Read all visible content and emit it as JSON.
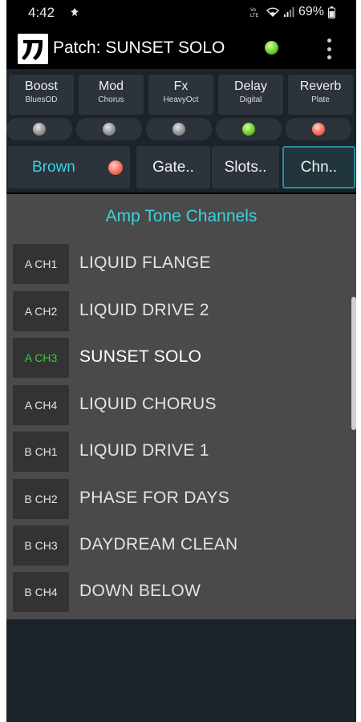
{
  "status_bar": {
    "time": "4:42",
    "battery": "69%",
    "icons": [
      "notification-icon",
      "volte-icon",
      "wifi-icon",
      "signal-icon",
      "battery-icon"
    ]
  },
  "app_bar": {
    "logo": "刀",
    "title": "Patch: SUNSET SOLO",
    "status_color": "#7ed83a",
    "menu_icon": "more-vert-icon"
  },
  "effects": [
    {
      "name": "Boost",
      "type": "BluesOD",
      "led": "grey"
    },
    {
      "name": "Mod",
      "type": "Chorus",
      "led": "grey"
    },
    {
      "name": "Fx",
      "type": "HeavyOct",
      "led": "grey"
    },
    {
      "name": "Delay",
      "type": "Digital",
      "led": "green"
    },
    {
      "name": "Reverb",
      "type": "Plate",
      "led": "red"
    }
  ],
  "nav": {
    "amp": "Brown",
    "amp_led": "red",
    "gate": "Gate..",
    "slots": "Slots..",
    "channels": "Chn.."
  },
  "section_title": "Amp Tone Channels",
  "channels": [
    {
      "label": "A CH1",
      "name": "LIQUID FLANGE",
      "active": false
    },
    {
      "label": "A CH2",
      "name": "LIQUID DRIVE 2",
      "active": false
    },
    {
      "label": "A CH3",
      "name": "SUNSET SOLO",
      "active": true
    },
    {
      "label": "A CH4",
      "name": "LIQUID CHORUS",
      "active": false
    },
    {
      "label": "B CH1",
      "name": "LIQUID DRIVE 1",
      "active": false
    },
    {
      "label": "B CH2",
      "name": "PHASE FOR DAYS",
      "active": false
    },
    {
      "label": "B CH3",
      "name": "DAYDREAM CLEAN",
      "active": false
    },
    {
      "label": "B CH4",
      "name": "DOWN BELOW",
      "active": false
    }
  ],
  "colors": {
    "accent": "#38d4e0",
    "active_channel": "#32d232",
    "led_green": "#7ed83a",
    "led_red": "#ff7a6a",
    "led_grey": "#a0a0a0"
  }
}
